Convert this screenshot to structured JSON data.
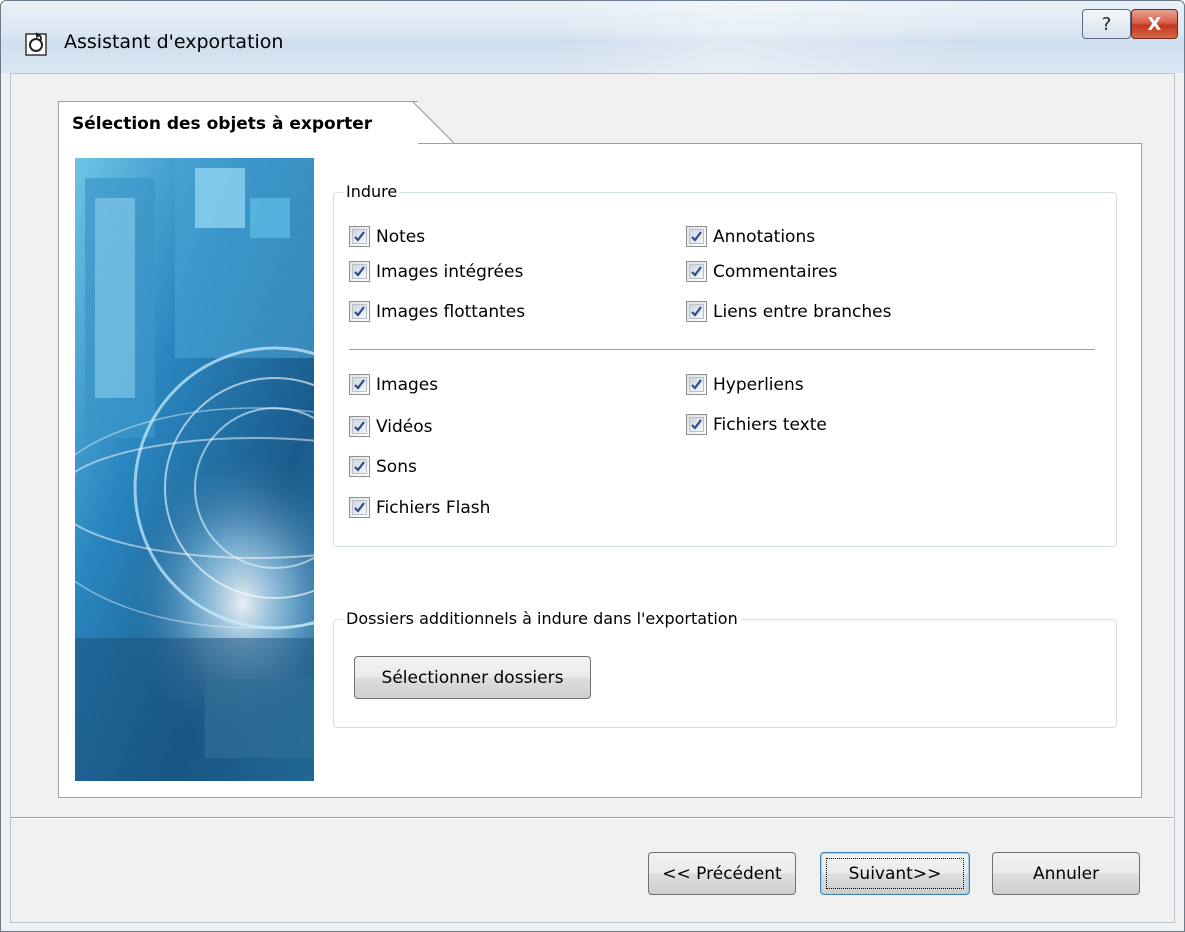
{
  "window": {
    "title": "Assistant d'exportation"
  },
  "titlebar_buttons": {
    "help_symbol": "?",
    "close_symbol": "X"
  },
  "tab": {
    "label": "Sélection des objets à exporter"
  },
  "include": {
    "legend": "Indure",
    "top_left": [
      {
        "label": "Notes",
        "checked": true
      },
      {
        "label": "Images intégrées",
        "checked": true
      },
      {
        "label": "Images flottantes",
        "checked": true
      }
    ],
    "top_right": [
      {
        "label": "Annotations",
        "checked": true
      },
      {
        "label": "Commentaires",
        "checked": true
      },
      {
        "label": "Liens entre branches",
        "checked": true
      }
    ],
    "bottom_left": [
      {
        "label": "Images",
        "checked": true
      },
      {
        "label": "Vidéos",
        "checked": true
      },
      {
        "label": "Sons",
        "checked": true
      },
      {
        "label": "Fichiers Flash",
        "checked": true
      }
    ],
    "bottom_right": [
      {
        "label": "Hyperliens",
        "checked": true
      },
      {
        "label": "Fichiers texte",
        "checked": true
      }
    ]
  },
  "folders": {
    "legend": "Dossiers additionnels à indure dans l'exportation",
    "select_button": "Sélectionner dossiers"
  },
  "footer": {
    "prev_label": "<< Précédent",
    "next_label": "Suivant>>",
    "cancel_label": "Annuler"
  },
  "colors": {
    "accent": "#3c7fb1",
    "close_red": "#c1361d",
    "check": "#2a4d8f"
  }
}
